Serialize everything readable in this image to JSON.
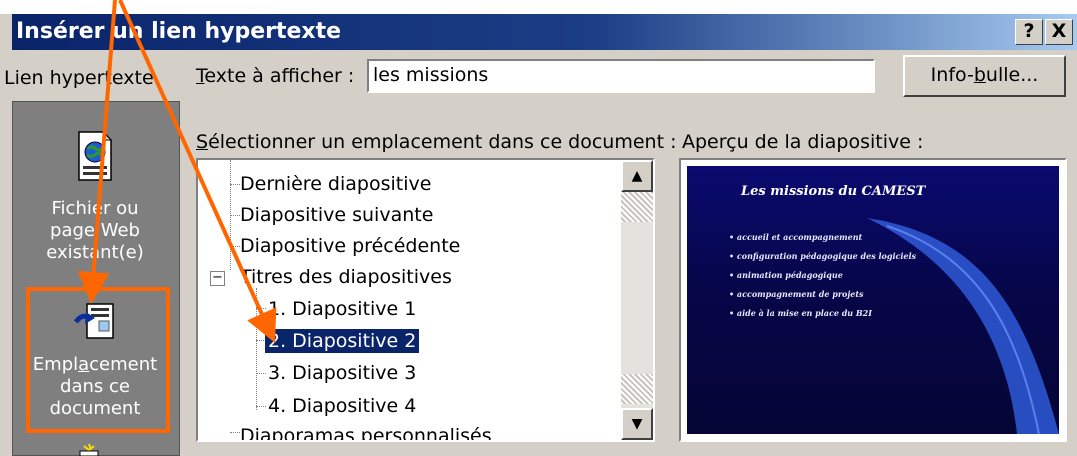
{
  "dialog": {
    "title": "Insérer un lien hypertexte",
    "help_button": "?",
    "close_button": "X"
  },
  "left_label": "Lien hypertexte",
  "text_to_display": {
    "label_prefix": "T",
    "label_rest": "exte à afficher :",
    "value": "les missions"
  },
  "tooltip_button": {
    "label_prefix": "Info-",
    "label_underlined": "b",
    "label_suffix": "ulle..."
  },
  "location_label": {
    "underlined": "S",
    "rest": "électionner un emplacement dans ce document :"
  },
  "preview_label": "Aperçu de la diapositive :",
  "sidebar": {
    "items": [
      {
        "label_line1": "Fichier ou",
        "label_line2": "page Web",
        "label_line3": "existant(e)",
        "icon": "web-page-icon"
      },
      {
        "label_line1_a": "Empl",
        "label_line1_u": "a",
        "label_line1_b": "cement",
        "label_line2": "dans ce",
        "label_line3": "document",
        "icon": "document-location-icon"
      }
    ]
  },
  "tree": {
    "items": [
      {
        "label": "Dernière diapositive"
      },
      {
        "label": "Diapositive suivante"
      },
      {
        "label": "Diapositive précédente"
      },
      {
        "label": "Titres des diapositives",
        "expander": "−"
      },
      {
        "label": "1. Diapositive 1"
      },
      {
        "label": "2. Diapositive 2",
        "selected": true
      },
      {
        "label": "3. Diapositive 3"
      },
      {
        "label": "4. Diapositive 4"
      },
      {
        "label": "Diaporamas personnalisés"
      }
    ]
  },
  "scrollbar": {
    "up": "▲",
    "down": "▼"
  },
  "slide_preview": {
    "title": "Les missions du CAMEST",
    "bullets": [
      "• accueil et accompagnement",
      "• configuration pédagogique des logiciels",
      "• animation pédagogique",
      "• accompagnement de projets",
      "• aide à la mise en place du B2I"
    ]
  },
  "colors": {
    "annotation": "#ff6600",
    "selection": "#0a246a",
    "titlebar": "#0a246a"
  }
}
